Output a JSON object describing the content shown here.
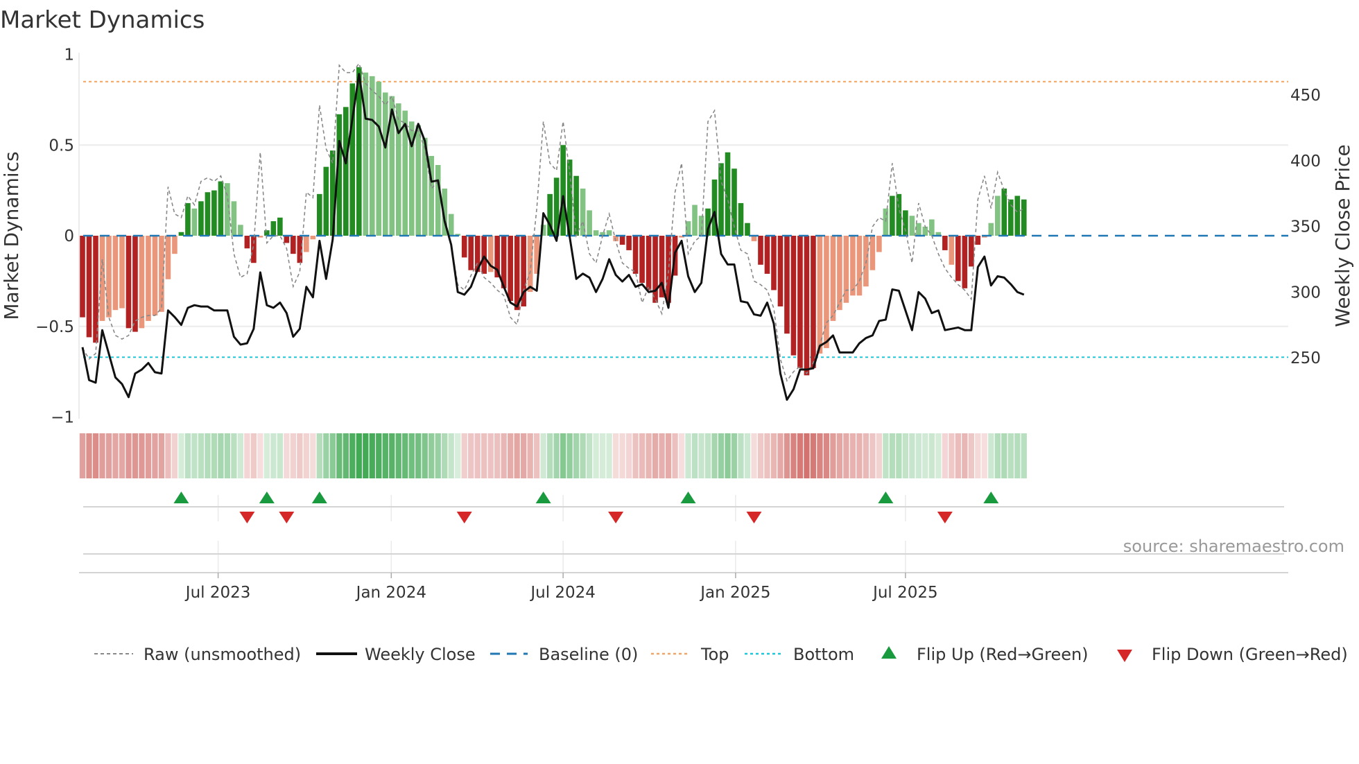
{
  "title": "Market Dynamics",
  "source": "source: sharemaestro.com",
  "colors": {
    "bar_strong_pos": "#228b22",
    "bar_weak_pos": "#82c282",
    "bar_strong_neg": "#b22222",
    "bar_weak_neg": "#e9967a",
    "heat_pos": "#2ea043",
    "heat_neg": "#c8504b",
    "raw": "#888888",
    "close": "#111111",
    "baseline": "#1f77b4",
    "top": "#f4a460",
    "bottom": "#22c5d5",
    "flip_up": "#1a9a3e",
    "flip_down": "#d62728"
  },
  "chart_data": {
    "type": "bar",
    "title": "Market Dynamics",
    "ylabel": "Market Dynamics",
    "y2label": "Weekly Close Price",
    "ylim": [
      -1,
      1
    ],
    "y2lim": [
      226.6,
      472.4
    ],
    "yticks": [
      {
        "v": 1,
        "label": "1"
      },
      {
        "v": 0.5,
        "label": "0.5"
      },
      {
        "v": 0,
        "label": "0"
      },
      {
        "v": -0.5,
        "label": "−0.5"
      },
      {
        "v": -1,
        "label": "−1"
      }
    ],
    "y2ticks": [
      {
        "v": 450,
        "label": "450"
      },
      {
        "v": 400,
        "label": "400"
      },
      {
        "v": 350,
        "label": "350"
      },
      {
        "v": 300,
        "label": "300"
      },
      {
        "v": 250,
        "label": "250"
      }
    ],
    "xticks": [
      {
        "week": 20.6,
        "label": "Jul 2023"
      },
      {
        "week": 46.9,
        "label": "Jan 2024"
      },
      {
        "week": 73.0,
        "label": "Jul 2024"
      },
      {
        "week": 99.2,
        "label": "Jan 2025"
      },
      {
        "week": 125.0,
        "label": "Jul 2025"
      }
    ],
    "top_level": 0.85,
    "bottom_level": -0.67,
    "baseline": 0,
    "grid": true,
    "legend_position": "bottom",
    "legend": [
      "Raw (unsmoothed)",
      "Weekly Close",
      "Baseline (0)",
      "Top",
      "Bottom",
      "Flip Up (Red→Green)",
      "Flip Down (Green→Red)"
    ],
    "bars": [
      -0.45,
      -0.56,
      -0.59,
      -0.47,
      -0.45,
      -0.41,
      -0.4,
      -0.51,
      -0.53,
      -0.51,
      -0.47,
      -0.44,
      -0.42,
      -0.24,
      -0.1,
      0.02,
      0.18,
      0.15,
      0.19,
      0.24,
      0.25,
      0.3,
      0.29,
      0.19,
      0.06,
      -0.07,
      -0.15,
      -0.01,
      0.03,
      0.08,
      0.1,
      -0.04,
      -0.1,
      -0.15,
      -0.09,
      -0.02,
      0.23,
      0.38,
      0.47,
      0.67,
      0.71,
      0.84,
      0.93,
      0.9,
      0.88,
      0.85,
      0.79,
      0.77,
      0.73,
      0.69,
      0.63,
      0.61,
      0.54,
      0.44,
      0.39,
      0.26,
      0.12,
      0.01,
      -0.12,
      -0.19,
      -0.2,
      -0.21,
      -0.2,
      -0.23,
      -0.29,
      -0.36,
      -0.41,
      -0.39,
      -0.31,
      -0.21,
      0.06,
      0.23,
      0.32,
      0.5,
      0.42,
      0.33,
      0.26,
      0.14,
      0.03,
      0.02,
      0.03,
      -0.03,
      -0.05,
      -0.08,
      -0.21,
      -0.26,
      -0.3,
      -0.37,
      -0.34,
      -0.37,
      -0.22,
      -0.01,
      0.08,
      0.17,
      0.11,
      0.15,
      0.31,
      0.4,
      0.46,
      0.37,
      0.18,
      0.07,
      -0.03,
      -0.16,
      -0.21,
      -0.3,
      -0.39,
      -0.54,
      -0.66,
      -0.73,
      -0.77,
      -0.73,
      -0.65,
      -0.62,
      -0.47,
      -0.41,
      -0.37,
      -0.33,
      -0.33,
      -0.28,
      -0.19,
      -0.09,
      0.15,
      0.22,
      0.23,
      0.14,
      0.11,
      0.07,
      0.05,
      0.09,
      0.02,
      -0.08,
      -0.16,
      -0.25,
      -0.29,
      -0.17,
      -0.05,
      -0.01,
      0.07,
      0.22,
      0.26,
      0.2,
      0.22,
      0.2
    ],
    "bar_strength": "dddllllddllllllddlddddlllddlddddddlldddddddlllllllllllllllddddldddddllldddddlllllldddddddddlllldddddddldddddddddllllllllllldddllllldlddddlllddddldl",
    "raw": [
      -0.62,
      -0.68,
      -0.65,
      -0.13,
      -0.45,
      -0.55,
      -0.57,
      -0.55,
      -0.47,
      -0.45,
      -0.44,
      -0.44,
      -0.4,
      0.27,
      0.12,
      0.1,
      0.22,
      0.17,
      0.3,
      0.32,
      0.3,
      0.33,
      0.22,
      -0.1,
      -0.23,
      -0.21,
      -0.05,
      0.46,
      -0.04,
      0.0,
      0.0,
      -0.07,
      -0.28,
      -0.2,
      0.24,
      0.21,
      0.72,
      0.48,
      0.4,
      0.94,
      0.9,
      0.9,
      0.95,
      0.84,
      0.8,
      0.77,
      0.72,
      0.77,
      0.64,
      0.62,
      0.58,
      0.58,
      0.48,
      0.26,
      0.3,
      0.1,
      -0.05,
      -0.27,
      -0.3,
      -0.22,
      -0.15,
      -0.23,
      -0.26,
      -0.3,
      -0.33,
      -0.45,
      -0.49,
      -0.3,
      -0.2,
      0.15,
      0.63,
      0.4,
      0.36,
      0.63,
      0.35,
      0.0,
      0.08,
      -0.1,
      -0.15,
      0.0,
      0.12,
      -0.03,
      -0.15,
      -0.18,
      -0.2,
      -0.37,
      -0.28,
      -0.35,
      -0.43,
      -0.2,
      0.24,
      0.4,
      -0.1,
      -0.03,
      0.0,
      0.63,
      0.69,
      0.3,
      0.2,
      0.05,
      -0.08,
      -0.1,
      -0.25,
      -0.27,
      -0.3,
      -0.4,
      -0.68,
      -0.8,
      -0.75,
      -0.72,
      -0.76,
      -0.7,
      -0.6,
      -0.48,
      -0.44,
      -0.37,
      -0.3,
      -0.3,
      -0.25,
      -0.15,
      0.05,
      0.1,
      0.08,
      0.4,
      0.15,
      0.03,
      -0.15,
      0.18,
      0.05,
      0.0,
      -0.1,
      -0.18,
      -0.23,
      -0.27,
      -0.3,
      -0.35,
      0.2,
      0.33,
      0.15,
      0.35,
      0.25,
      0.17,
      0.13,
      0.15
    ],
    "weekly_close": [
      258,
      233,
      231,
      271,
      253,
      235,
      230,
      220,
      238,
      241,
      246,
      239,
      238,
      286,
      281,
      275,
      288,
      290,
      289,
      289,
      286,
      286,
      286,
      266,
      260,
      261,
      272,
      315,
      290,
      288,
      292,
      284,
      266,
      272,
      304,
      296,
      339,
      310,
      340,
      415,
      398,
      432,
      466,
      432,
      431,
      426,
      410,
      439,
      421,
      428,
      411,
      428,
      415,
      384,
      385,
      354,
      336,
      300,
      298,
      304,
      317,
      327,
      320,
      317,
      304,
      292,
      289,
      300,
      304,
      301,
      360,
      351,
      339,
      373,
      342,
      310,
      314,
      311,
      300,
      310,
      325,
      313,
      308,
      313,
      304,
      306,
      300,
      301,
      307,
      288,
      330,
      339,
      312,
      300,
      307,
      348,
      361,
      329,
      321,
      321,
      293,
      292,
      283,
      282,
      292,
      276,
      238,
      218,
      226,
      241,
      241,
      242,
      259,
      262,
      267,
      254,
      254,
      254,
      261,
      265,
      267,
      278,
      279,
      302,
      301,
      286,
      271,
      300,
      295,
      284,
      286,
      271,
      272,
      273,
      271,
      271,
      319,
      327,
      305,
      312,
      311,
      306,
      300,
      298
    ],
    "flip_up_weeks": [
      15,
      28,
      36,
      70,
      92,
      122,
      138
    ],
    "flip_down_weeks": [
      25,
      31,
      58,
      81,
      102,
      131
    ]
  }
}
